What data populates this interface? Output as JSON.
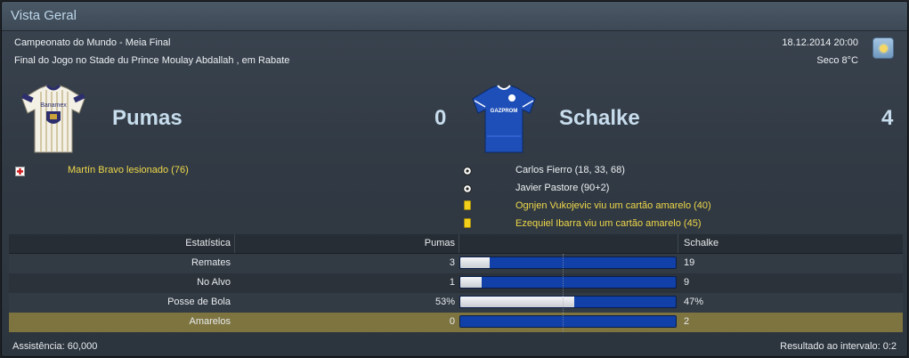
{
  "title": "Vista Geral",
  "match": {
    "competition": "Campeonato do Mundo - Meia Final",
    "venue": "Final do Jogo no Stade du Prince Moulay Abdallah , em Rabate",
    "datetime": "18.12.2014 20:00",
    "weather": "Seco 8°C",
    "weather_icon": "sunny-icon"
  },
  "home": {
    "name": "Pumas",
    "score": "0",
    "shirt_sponsor": "Banamex"
  },
  "away": {
    "name": "Schalke",
    "score": "4",
    "shirt_sponsor": "GAZPROM"
  },
  "home_events": [
    {
      "icon": "injury-icon",
      "text": "Martín Bravo lesionado (76)"
    }
  ],
  "away_events": [
    {
      "icon": "goal-ball-icon",
      "text": "Carlos Fierro (18, 33, 68)"
    },
    {
      "icon": "goal-ball-icon",
      "text": "Javier Pastore (90+2)"
    },
    {
      "icon": "yellow-card-icon",
      "text": "Ognjen Vukojevic viu um cartão amarelo (40)"
    },
    {
      "icon": "yellow-card-icon",
      "text": "Ezequiel Ibarra viu um cartão amarelo (45)"
    }
  ],
  "stats": {
    "header": {
      "label": "Estatística",
      "home": "Pumas",
      "away": "Schalke"
    },
    "rows": [
      {
        "label": "Remates",
        "home": "3",
        "away": "19",
        "home_share": 0.136
      },
      {
        "label": "No Alvo",
        "home": "1",
        "away": "9",
        "home_share": 0.1
      },
      {
        "label": "Posse de Bola",
        "home": "53%",
        "away": "47%",
        "home_share": 0.53
      },
      {
        "label": "Amarelos",
        "home": "0",
        "away": "2",
        "home_share": 0.0
      }
    ]
  },
  "footer": {
    "attendance": "Assistência: 60,000",
    "halftime": "Resultado ao intervalo: 0:2"
  },
  "colors": {
    "bar_home": "#f0f2f4",
    "bar_away": "#1040a8",
    "yellow_text": "#f0d84a",
    "highlight_row": "#7e7440"
  }
}
